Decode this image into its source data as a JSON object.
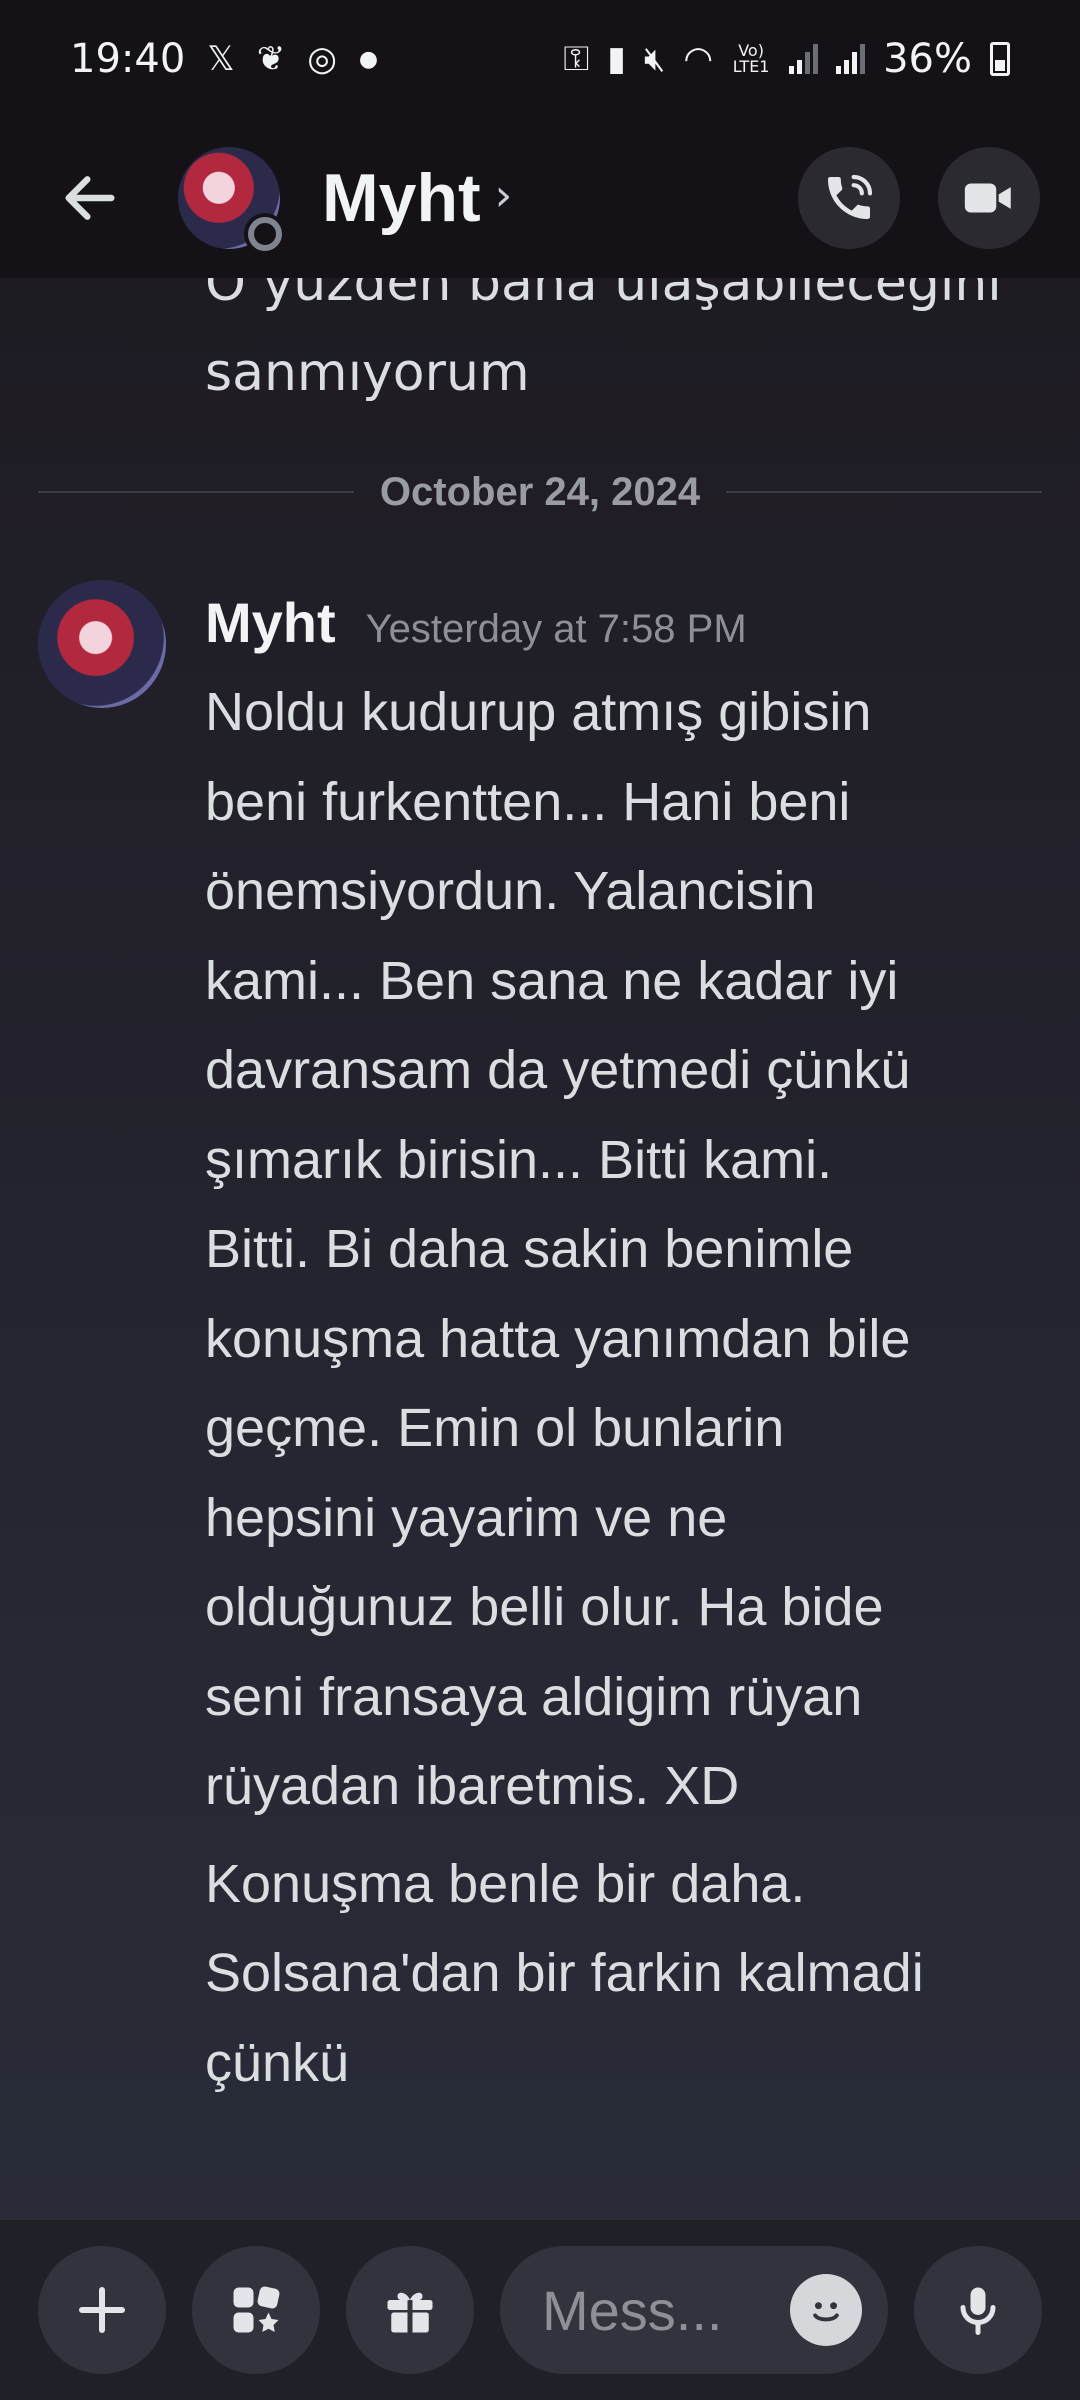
{
  "status_bar": {
    "time": "19:40",
    "network_label": "Vo) LTE1",
    "battery": "36%"
  },
  "header": {
    "name": "Myht",
    "chevron": "›"
  },
  "chat": {
    "previous_message_lines": [
      "O yüzden bana ulaşabileceğini",
      "sanmıyorum"
    ],
    "date_divider": "October 24, 2024",
    "message": {
      "author": "Myht",
      "timestamp": "Yesterday at 7:58 PM",
      "paragraph_1_lines": [
        "Noldu kudurup atmış gibisin",
        "beni furkentten... Hani beni",
        "önemsiyordun. Yalancisin",
        "kami... Ben sana ne kadar iyi",
        "davransam da yetmedi çünkü",
        "şımarık birisin... Bitti kami.",
        "Bitti. Bi daha sakin benimle",
        "konuşma hatta yanımdan bile",
        "geçme. Emin ol bunlarin",
        "hepsini yayarim ve ne",
        "olduğunuz belli olur. Ha bide",
        "seni fransaya aldigim rüyan",
        "rüyadan ibaretmis. XD"
      ],
      "paragraph_2_lines": [
        "Konuşma benle bir daha.",
        "Solsana'dan bir farkin kalmadi",
        "çünkü"
      ]
    }
  },
  "composer": {
    "placeholder": "Mess..."
  },
  "icons": {
    "back": "arrow-left-icon",
    "call": "phone-icon",
    "video": "video-camera-icon",
    "add": "plus-icon",
    "apps": "apps-icon",
    "gift": "gift-icon",
    "emoji": "emoji-icon",
    "mic": "microphone-icon"
  },
  "colors": {
    "background_top": "#1c191f",
    "background_bottom": "#2a2e3a",
    "header_bg": "#141216",
    "text": "#dbdee1",
    "muted_text": "#8e9097"
  }
}
